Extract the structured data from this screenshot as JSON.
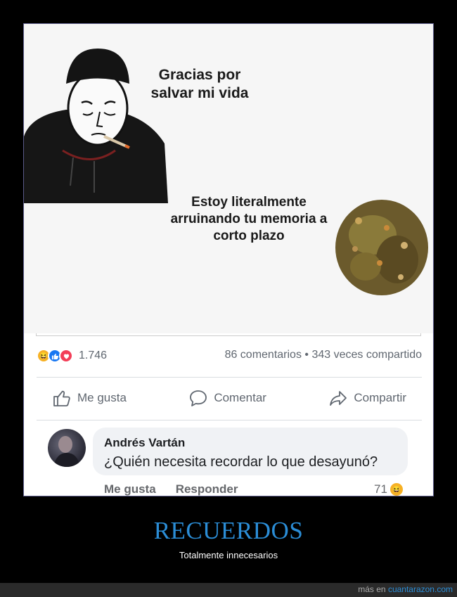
{
  "meme": {
    "caption_person": "Gracias por salvar mi vida",
    "caption_plant": "Estoy literalmente arruinando tu memoria a corto plazo"
  },
  "post": {
    "reaction_count": "1.746",
    "comments": "86 comentarios",
    "separator": "•",
    "shares": "343 veces compartido",
    "reactions": [
      "haha-icon",
      "like-icon",
      "love-icon"
    ],
    "colors": {
      "haha": "#f7b125",
      "like": "#1877f2",
      "love": "#f33e58"
    }
  },
  "actions": {
    "like": "Me gusta",
    "comment": "Comentar",
    "share": "Compartir"
  },
  "comment": {
    "author": "Andrés Vartán",
    "text": "¿Quién necesita recordar lo que desayunó?",
    "like": "Me gusta",
    "reply": "Responder",
    "likes_count": "71"
  },
  "site": {
    "title": "RECUERDOS",
    "subtitle": "Totalmente innecesarios",
    "footer_prefix": "más en",
    "footer_link": "cuantarazon.com",
    "accent": "#2b8dd6"
  }
}
